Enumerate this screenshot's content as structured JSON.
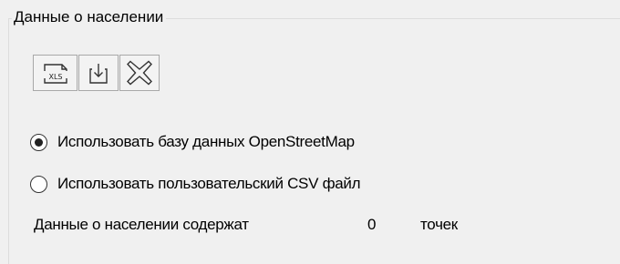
{
  "group": {
    "title": "Данные о населении"
  },
  "toolbar": {
    "buttons": [
      {
        "icon": "xls-file-icon",
        "label": "XLS"
      },
      {
        "icon": "download-icon"
      },
      {
        "icon": "clear-icon"
      }
    ]
  },
  "source_options": [
    {
      "label": "Использовать базу данных OpenStreetMap",
      "selected": true
    },
    {
      "label": "Использовать пользовательский CSV файл",
      "selected": false
    }
  ],
  "summary": {
    "prefix": "Данные о населении содержат",
    "count": "0",
    "unit": "точек"
  }
}
